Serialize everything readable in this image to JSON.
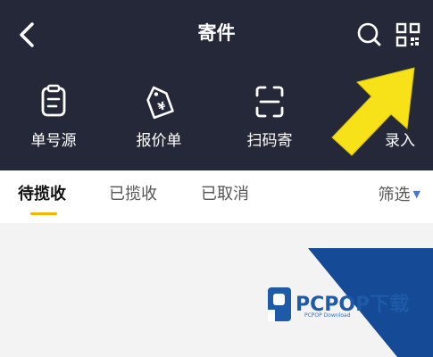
{
  "header": {
    "title": "寄件"
  },
  "actions": [
    {
      "label": "单号源",
      "icon": "clipboard-icon"
    },
    {
      "label": "报价单",
      "icon": "price-tag-icon"
    },
    {
      "label": "扫码寄",
      "icon": "scan-icon"
    },
    {
      "label": "录入",
      "icon": "record-entry-icon"
    }
  ],
  "tabs": [
    {
      "label": "待揽收",
      "active": true
    },
    {
      "label": "已揽收",
      "active": false
    },
    {
      "label": "已取消",
      "active": false
    }
  ],
  "filter": {
    "label": "筛选"
  },
  "watermark": {
    "brand": "PCPOP下载",
    "sub": "PCPOP Download"
  },
  "colors": {
    "header_bg": "#252838",
    "tab_indicator": "#f4b400",
    "arrow": "#f7e21a",
    "watermark_blue": "#1d5aa8"
  }
}
